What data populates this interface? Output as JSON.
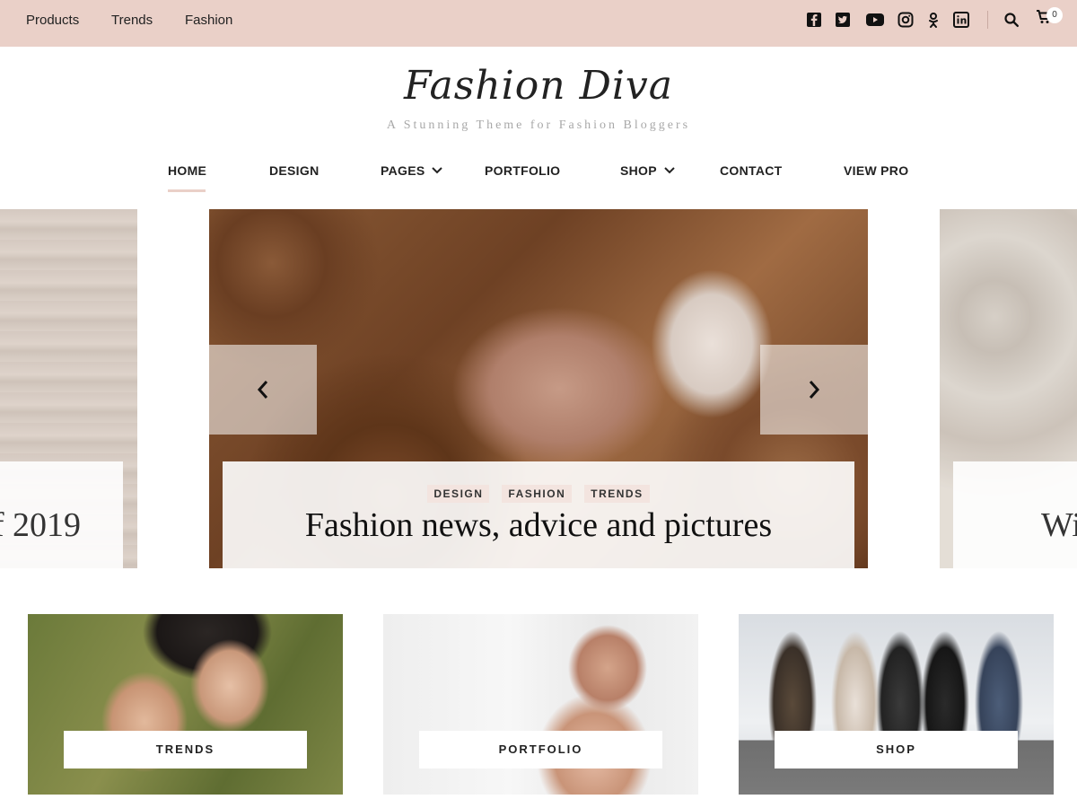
{
  "topbar": {
    "links": [
      "Products",
      "Trends",
      "Fashion"
    ],
    "social_icons": [
      "facebook-icon",
      "twitter-icon",
      "youtube-icon",
      "instagram-icon",
      "odnoklassniki-icon",
      "linkedin-icon"
    ],
    "cart_count": "0",
    "background_color": "#ead0c8"
  },
  "branding": {
    "title": "Fashion Diva",
    "tagline": "A Stunning Theme for Fashion Bloggers"
  },
  "nav": {
    "items": [
      {
        "label": "HOME",
        "active": true
      },
      {
        "label": "DESIGN"
      },
      {
        "label": "PAGES",
        "has_dropdown": true
      },
      {
        "label": "PORTFOLIO"
      },
      {
        "label": "SHOP",
        "has_dropdown": true
      },
      {
        "label": "CONTACT"
      },
      {
        "label": "VIEW PRO"
      }
    ]
  },
  "slider": {
    "prev_slide_caption": "f 2019",
    "next_slide_caption": "Wi",
    "current": {
      "categories": [
        "DESIGN",
        "FASHION",
        "TRENDS"
      ],
      "headline": "Fashion news, advice and pictures"
    }
  },
  "cards": [
    {
      "label": "TRENDS"
    },
    {
      "label": "PORTFOLIO"
    },
    {
      "label": "SHOP"
    }
  ]
}
